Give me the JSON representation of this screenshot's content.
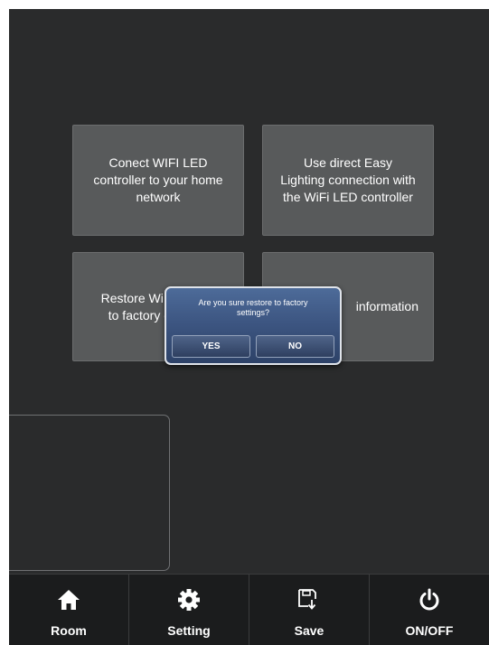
{
  "tiles": [
    {
      "label": "Conect WIFI LED\ncontroller to your home\nnetwork"
    },
    {
      "label": "Use direct Easy\nLighting connection with\nthe WiFi LED controller"
    },
    {
      "label": "Restore WiFi factory\nto factory defaults"
    },
    {
      "label": "information"
    }
  ],
  "dialog": {
    "message": "Are you sure restore to factory\nsettings?",
    "yes_label": "YES",
    "no_label": "NO"
  },
  "bottom_bar": {
    "items": [
      {
        "label": "Room",
        "icon": "home-icon"
      },
      {
        "label": "Setting",
        "icon": "gear-icon"
      },
      {
        "label": "Save",
        "icon": "save-icon"
      },
      {
        "label": "ON/OFF",
        "icon": "power-icon"
      }
    ]
  },
  "colors": {
    "background": "#2a2b2c",
    "tile": "#585a5b",
    "bar": "#1b1c1d",
    "dialog_accent": "#3d5682"
  }
}
